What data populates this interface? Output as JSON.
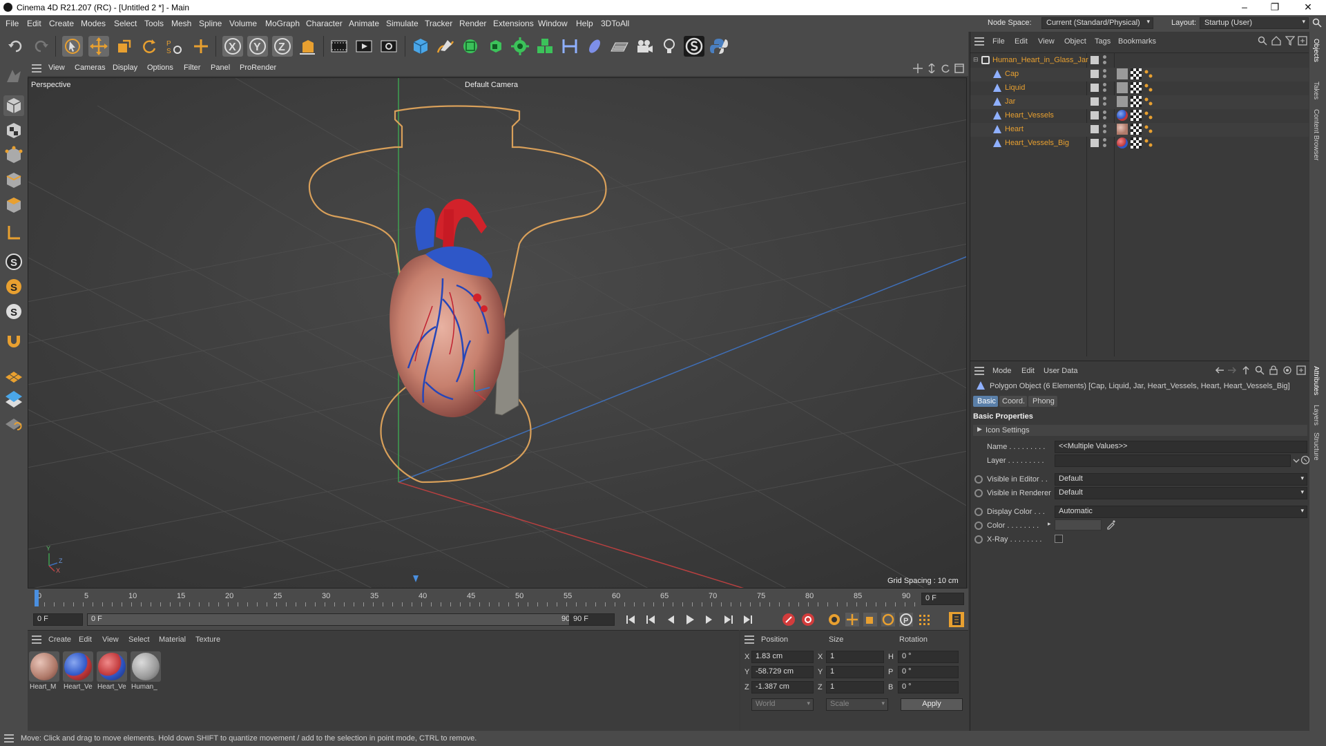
{
  "window": {
    "title": "Cinema 4D R21.207 (RC) - [Untitled 2 *] - Main",
    "controls": [
      "–",
      "❐",
      "✕"
    ]
  },
  "menu": {
    "items": [
      "File",
      "Edit",
      "Create",
      "Modes",
      "Select",
      "Tools",
      "Mesh",
      "Spline",
      "Volume",
      "MoGraph",
      "Character",
      "Animate",
      "Simulate",
      "Tracker",
      "Render",
      "Extensions",
      "Window",
      "Help",
      "3DToAll"
    ],
    "node_space_label": "Node Space:",
    "node_space_value": "Current (Standard/Physical)",
    "layout_label": "Layout:",
    "layout_value": "Startup (User)"
  },
  "viewport_menu": {
    "items": [
      "View",
      "Cameras",
      "Display",
      "Options",
      "Filter",
      "Panel",
      "ProRender"
    ]
  },
  "viewport": {
    "label": "Perspective",
    "camera_label": "Default Camera",
    "grid_spacing": "Grid Spacing : 10 cm",
    "axis_y": "Y",
    "axis_z": "Z",
    "axis_x": "X"
  },
  "timeline": {
    "ticks": [
      "0",
      "5",
      "10",
      "15",
      "20",
      "25",
      "30",
      "35",
      "40",
      "45",
      "50",
      "55",
      "60",
      "65",
      "70",
      "75",
      "80",
      "85",
      "90"
    ],
    "current_frame": "0 F"
  },
  "transport": {
    "start_field": "0 F",
    "range_start": "0 F",
    "range_end": "90 F",
    "end_field": "90 F"
  },
  "material_manager": {
    "menu": [
      "Create",
      "Edit",
      "View",
      "Select",
      "Material",
      "Texture"
    ],
    "materials": [
      {
        "name": "Heart_M",
        "color": "#b07a6a"
      },
      {
        "name": "Heart_Ve",
        "color": "#c0383a"
      },
      {
        "name": "Heart_Ve",
        "color": "#3a5fb0"
      },
      {
        "name": "Human_",
        "color": "#9a9a9a"
      }
    ]
  },
  "coordinates": {
    "headers": [
      "Position",
      "Size",
      "Rotation"
    ],
    "rows": [
      {
        "axis": "X",
        "pos": "1.83 cm",
        "size_axis": "X",
        "size": "1",
        "rot_axis": "H",
        "rot": "0 °"
      },
      {
        "axis": "Y",
        "pos": "-58.729 cm",
        "size_axis": "Y",
        "size": "1",
        "rot_axis": "P",
        "rot": "0 °"
      },
      {
        "axis": "Z",
        "pos": "-1.387 cm",
        "size_axis": "Z",
        "size": "1",
        "rot_axis": "B",
        "rot": "0 °"
      }
    ],
    "mode_world": "World",
    "mode_scale": "Scale",
    "apply_label": "Apply"
  },
  "status_bar": {
    "text": "Move: Click and drag to move elements. Hold down SHIFT to quantize movement / add to the selection in point mode, CTRL to remove."
  },
  "object_manager": {
    "menu": [
      "File",
      "Edit",
      "View",
      "Object",
      "Tags",
      "Bookmarks"
    ],
    "root": "Human_Heart_in_Glass_Jar",
    "children": [
      "Cap",
      "Liquid",
      "Jar",
      "Heart_Vessels",
      "Heart",
      "Heart_Vessels_Big"
    ],
    "accent_color": "#e8a030"
  },
  "attributes": {
    "menu": [
      "Mode",
      "Edit",
      "User Data"
    ],
    "object_desc": "Polygon Object (6 Elements) [Cap, Liquid, Jar, Heart_Vessels, Heart, Heart_Vessels_Big]",
    "tabs": [
      "Basic",
      "Coord.",
      "Phong"
    ],
    "section": "Basic Properties",
    "icon_settings": "Icon Settings",
    "name_label": "Name . . . . . . . . .",
    "name_value": "<<Multiple Values>>",
    "layer_label": "Layer . . . . . . . . .",
    "visible_editor_label": "Visible in Editor . .",
    "visible_editor_value": "Default",
    "visible_renderer_label": "Visible in Renderer",
    "visible_renderer_value": "Default",
    "display_color_label": "Display Color . . .",
    "display_color_value": "Automatic",
    "color_label": "Color . . . . . . . .",
    "xray_label": "X-Ray . . . . . . . ."
  },
  "right_tabs": [
    "Objects",
    "Takes",
    "Content Browser",
    "Attributes",
    "Layers",
    "Structure"
  ]
}
